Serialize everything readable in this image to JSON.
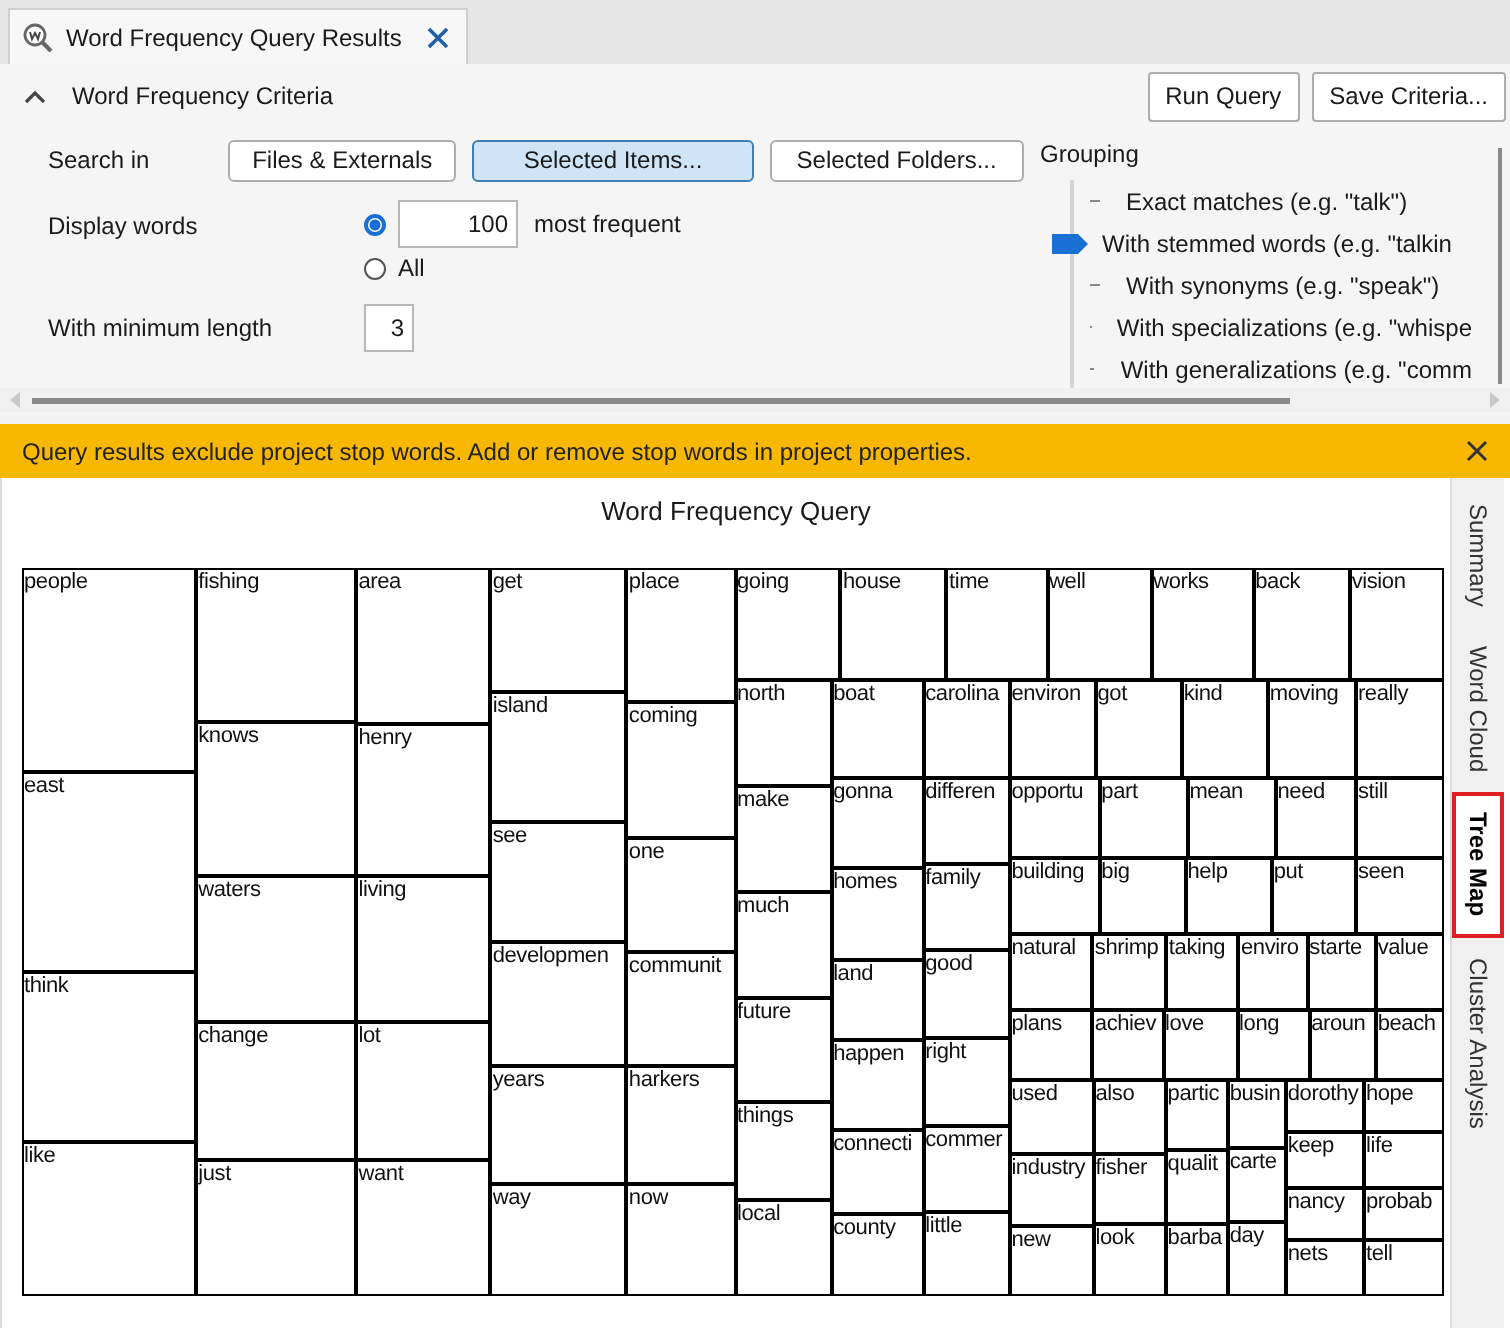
{
  "tab": {
    "title": "Word Frequency Query Results"
  },
  "criteria": {
    "title": "Word Frequency Criteria",
    "expanded": true,
    "actions": [
      "Run Query",
      "Save Criteria..."
    ],
    "search_in": {
      "label": "Search in",
      "options": [
        {
          "label": "Files & Externals",
          "selected": false
        },
        {
          "label": "Selected Items...",
          "selected": true
        },
        {
          "label": "Selected Folders...",
          "selected": false
        }
      ]
    },
    "display_words": {
      "label": "Display words",
      "options": [
        {
          "label": "most frequent",
          "value": "100",
          "selected": true
        },
        {
          "label": "All",
          "selected": false
        }
      ]
    },
    "minimum_length": {
      "label": "With minimum length",
      "value": "3"
    },
    "grouping": {
      "label": "Grouping",
      "items": [
        {
          "label": "Exact matches (e.g. \"talk\")",
          "selected": false
        },
        {
          "label": "With stemmed words (e.g. \"talkin",
          "selected": true
        },
        {
          "label": "With synonyms (e.g. \"speak\")",
          "selected": false
        },
        {
          "label": "With specializations (e.g. \"whispe",
          "selected": false
        },
        {
          "label": "With generalizations (e.g. \"comm",
          "selected": false
        }
      ]
    }
  },
  "banner": {
    "message": "Query results exclude project stop words. Add or remove stop words in project properties.",
    "closable": true
  },
  "view_tabs": [
    {
      "label": "Summary",
      "selected": false
    },
    {
      "label": "Word Cloud",
      "selected": false
    },
    {
      "label": "Tree Map",
      "selected": true
    },
    {
      "label": "Cluster Analysis",
      "selected": false
    }
  ],
  "tree_map": {
    "title": "Word Frequency Query",
    "layout": {
      "kind": "row",
      "children": [
        {
          "kind": "column",
          "children": [
            {
              "kind": "word",
              "word": "people"
            },
            {
              "kind": "word",
              "word": "east"
            },
            {
              "kind": "word",
              "word": "think"
            },
            {
              "kind": "word",
              "word": "like"
            }
          ]
        },
        {
          "kind": "column",
          "children": [
            {
              "kind": "word",
              "word": "fishing"
            },
            {
              "kind": "word",
              "word": "knows"
            },
            {
              "kind": "word",
              "word": "waters"
            },
            {
              "kind": "word",
              "word": "change"
            },
            {
              "kind": "word",
              "word": "just"
            }
          ]
        },
        {
          "kind": "column",
          "children": [
            {
              "kind": "word",
              "word": "area"
            },
            {
              "kind": "word",
              "word": "henry"
            },
            {
              "kind": "word",
              "word": "living"
            },
            {
              "kind": "word",
              "word": "lot"
            },
            {
              "kind": "word",
              "word": "want"
            }
          ]
        },
        {
          "kind": "column",
          "children": [
            {
              "kind": "word",
              "word": "get"
            },
            {
              "kind": "word",
              "word": "island"
            },
            {
              "kind": "word",
              "word": "see"
            },
            {
              "kind": "word",
              "word": "developmen"
            },
            {
              "kind": "word",
              "word": "years"
            },
            {
              "kind": "word",
              "word": "way"
            }
          ]
        },
        {
          "kind": "column",
          "children": [
            {
              "kind": "word",
              "word": "place"
            },
            {
              "kind": "word",
              "word": "coming"
            },
            {
              "kind": "word",
              "word": "one"
            },
            {
              "kind": "word",
              "word": "communit"
            },
            {
              "kind": "word",
              "word": "harkers"
            },
            {
              "kind": "word",
              "word": "now"
            }
          ]
        },
        {
          "kind": "column",
          "children": [
            {
              "kind": "row",
              "children": [
                {
                  "kind": "word",
                  "word": "going"
                },
                {
                  "kind": "word",
                  "word": "house"
                },
                {
                  "kind": "word",
                  "word": "time"
                },
                {
                  "kind": "word",
                  "word": "well"
                },
                {
                  "kind": "word",
                  "word": "works"
                },
                {
                  "kind": "word",
                  "word": "back"
                },
                {
                  "kind": "word",
                  "word": "vision"
                }
              ]
            },
            {
              "kind": "row",
              "children": [
                {
                  "kind": "column",
                  "children": [
                    {
                      "kind": "word",
                      "word": "north"
                    },
                    {
                      "kind": "word",
                      "word": "make"
                    },
                    {
                      "kind": "word",
                      "word": "much"
                    },
                    {
                      "kind": "word",
                      "word": "future"
                    },
                    {
                      "kind": "word",
                      "word": "things"
                    },
                    {
                      "kind": "word",
                      "word": "local"
                    }
                  ]
                },
                {
                  "kind": "column",
                  "children": [
                    {
                      "kind": "word",
                      "word": "boat"
                    },
                    {
                      "kind": "word",
                      "word": "gonna"
                    },
                    {
                      "kind": "word",
                      "word": "homes"
                    },
                    {
                      "kind": "word",
                      "word": "land"
                    },
                    {
                      "kind": "word",
                      "word": "happen"
                    },
                    {
                      "kind": "word",
                      "word": "connecti"
                    },
                    {
                      "kind": "word",
                      "word": "county"
                    }
                  ]
                },
                {
                  "kind": "column",
                  "children": [
                    {
                      "kind": "word",
                      "word": "carolina"
                    },
                    {
                      "kind": "word",
                      "word": "differen"
                    },
                    {
                      "kind": "word",
                      "word": "family"
                    },
                    {
                      "kind": "word",
                      "word": "good"
                    },
                    {
                      "kind": "word",
                      "word": "right"
                    },
                    {
                      "kind": "word",
                      "word": "commer"
                    },
                    {
                      "kind": "word",
                      "word": "little"
                    }
                  ]
                },
                {
                  "kind": "column",
                  "children": [
                    {
                      "kind": "row",
                      "children": [
                        {
                          "kind": "word",
                          "word": "environ"
                        },
                        {
                          "kind": "word",
                          "word": "got"
                        },
                        {
                          "kind": "word",
                          "word": "kind"
                        },
                        {
                          "kind": "word",
                          "word": "moving"
                        },
                        {
                          "kind": "word",
                          "word": "really"
                        }
                      ]
                    },
                    {
                      "kind": "row",
                      "children": [
                        {
                          "kind": "word",
                          "word": "opportu"
                        },
                        {
                          "kind": "word",
                          "word": "part"
                        },
                        {
                          "kind": "word",
                          "word": "mean"
                        },
                        {
                          "kind": "word",
                          "word": "need"
                        },
                        {
                          "kind": "word",
                          "word": "still"
                        }
                      ]
                    },
                    {
                      "kind": "row",
                      "children": [
                        {
                          "kind": "word",
                          "word": "building"
                        },
                        {
                          "kind": "word",
                          "word": "big"
                        },
                        {
                          "kind": "word",
                          "word": "help"
                        },
                        {
                          "kind": "word",
                          "word": "put"
                        },
                        {
                          "kind": "word",
                          "word": "seen"
                        }
                      ]
                    },
                    {
                      "kind": "row",
                      "children": [
                        {
                          "kind": "word",
                          "word": "natural"
                        },
                        {
                          "kind": "word",
                          "word": "shrimp"
                        },
                        {
                          "kind": "word",
                          "word": "taking"
                        },
                        {
                          "kind": "word",
                          "word": "enviro"
                        },
                        {
                          "kind": "word",
                          "word": "starte"
                        },
                        {
                          "kind": "word",
                          "word": "value"
                        }
                      ]
                    },
                    {
                      "kind": "row",
                      "children": [
                        {
                          "kind": "word",
                          "word": "plans"
                        },
                        {
                          "kind": "word",
                          "word": "achiev"
                        },
                        {
                          "kind": "word",
                          "word": "love"
                        },
                        {
                          "kind": "word",
                          "word": "long"
                        },
                        {
                          "kind": "word",
                          "word": "aroun"
                        },
                        {
                          "kind": "word",
                          "word": "beach"
                        }
                      ]
                    },
                    {
                      "kind": "row",
                      "children": [
                        {
                          "kind": "column",
                          "children": [
                            {
                              "kind": "word",
                              "word": "used"
                            },
                            {
                              "kind": "word",
                              "word": "industry"
                            },
                            {
                              "kind": "word",
                              "word": "new"
                            }
                          ]
                        },
                        {
                          "kind": "column",
                          "children": [
                            {
                              "kind": "word",
                              "word": "also"
                            },
                            {
                              "kind": "word",
                              "word": "fisher"
                            },
                            {
                              "kind": "word",
                              "word": "look"
                            }
                          ]
                        },
                        {
                          "kind": "column",
                          "children": [
                            {
                              "kind": "word",
                              "word": "partic"
                            },
                            {
                              "kind": "word",
                              "word": "qualit"
                            },
                            {
                              "kind": "word",
                              "word": "barba"
                            }
                          ]
                        },
                        {
                          "kind": "column",
                          "children": [
                            {
                              "kind": "word",
                              "word": "busin"
                            },
                            {
                              "kind": "word",
                              "word": "carte"
                            },
                            {
                              "kind": "word",
                              "word": "day"
                            }
                          ]
                        },
                        {
                          "kind": "column",
                          "children": [
                            {
                              "kind": "row",
                              "children": [
                                {
                                  "kind": "word",
                                  "word": "dorothy"
                                },
                                {
                                  "kind": "word",
                                  "word": "hope"
                                }
                              ]
                            },
                            {
                              "kind": "row",
                              "children": [
                                {
                                  "kind": "word",
                                  "word": "keep"
                                },
                                {
                                  "kind": "word",
                                  "word": "life"
                                }
                              ]
                            },
                            {
                              "kind": "row",
                              "children": [
                                {
                                  "kind": "word",
                                  "word": "nancy"
                                },
                                {
                                  "kind": "word",
                                  "word": "probab"
                                }
                              ]
                            },
                            {
                              "kind": "row",
                              "children": [
                                {
                                  "kind": "word",
                                  "word": "nets"
                                },
                                {
                                  "kind": "word",
                                  "word": "tell"
                                }
                              ]
                            }
                          ]
                        }
                      ]
                    }
                  ]
                }
              ]
            }
          ]
        }
      ]
    }
  }
}
